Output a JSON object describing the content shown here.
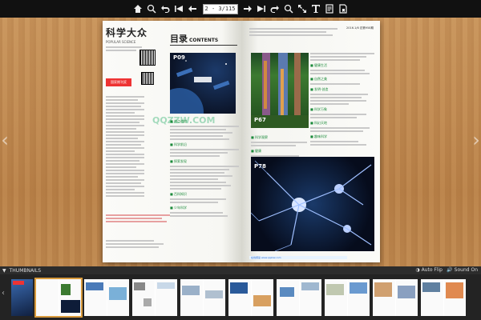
{
  "toolbar": {
    "page_value": "2 - 3/115",
    "icons": [
      "home-icon",
      "zoom-in-icon",
      "undo-icon",
      "first-page-icon",
      "prev-page-icon",
      "next-page-icon",
      "last-page-icon",
      "redo-icon",
      "search-icon",
      "fullscreen-icon",
      "text-icon",
      "print-icon",
      "bookmark-icon"
    ]
  },
  "left_page": {
    "mag_title": "科学大众",
    "mag_title_pinyin": "POPULAR SCIENCE",
    "logo_text": "国家期刊奖",
    "watermark": "QQZZW.COM"
  },
  "toc": {
    "heading": "目录",
    "heading_en": "CONTENTS",
    "photo1_label": "P09",
    "photo2_label": "P67",
    "photo3_label": "P78"
  },
  "right_page": {
    "issue_label": "2016.1/6 总第958期",
    "footer_link": "在线阅读 www.qqzzw.com"
  },
  "thumbnail_bar": {
    "title": "THUMBNAILS",
    "auto_flip": "Auto Flip",
    "sound_on": "Sound On"
  },
  "colors": {
    "toolbar_bg": "#111111",
    "thumbbar_bg": "#232323",
    "active_thumb": "#d89a3c",
    "section_green": "#1a8a3a"
  }
}
